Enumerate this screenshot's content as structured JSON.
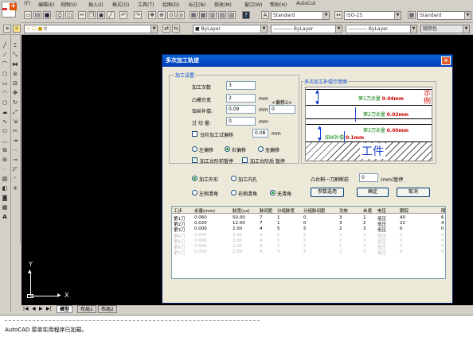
{
  "menu": {
    "items": [
      "(F)",
      "编辑(E)",
      "视图(V)",
      "插入(I)",
      "格式(O)",
      "工具(T)",
      "绘图(D)",
      "标注(N)",
      "修改(M)",
      "窗口(W)",
      "帮助(H)",
      "AutoCut"
    ]
  },
  "toolbar": {
    "text_style": "Standard",
    "dim_style": "ISO-25",
    "table_style": "Standard",
    "layer_value": "0",
    "color_value": "ByLayer",
    "linetype_value": "ByLayer",
    "lineweight_value": "ByLayer",
    "plotstyle_value": "随颜色"
  },
  "canvas": {
    "y_axis": "Y",
    "x_axis": "X"
  },
  "layout_tabs": [
    "模型",
    "布局1",
    "布局2"
  ],
  "command_line": "AutoCAD 菜单实用程序已加载。",
  "dialog": {
    "title": "多次加工轨迹",
    "close_label": "×",
    "settings_group": "加工设置",
    "times_label": "加工次数",
    "times_value": "3",
    "platform_label": "凸模台宽",
    "platform_value": "2",
    "platform_unit": "mm",
    "offset_label": "<偏移2>",
    "offset_value": "0",
    "wire_label": "钼丝补偿:",
    "wire_value": "0.09",
    "wire_unit": "mm",
    "overcut_label": "过 切 量:",
    "overcut_value": "0",
    "overcut_unit": "mm",
    "platform_cut_label": "台阶加工试偏移",
    "platform_cut_value": "0.08",
    "platform_cut_unit": "mm",
    "offset_left": "左偏移",
    "offset_right": "右偏移",
    "offset_none": "无偏移",
    "pause_before": "加工台阶前暂停",
    "pause_after": "加工台阶后 暂停",
    "diagram_group": "多次加工补偿示意图",
    "diagram": {
      "cut1": "第1刀余量",
      "cut1_val": "0.04mm",
      "cut2": "第2刀余量",
      "cut2_val": "0.02mm",
      "cut3": "第3刀余量",
      "cut3_val": "0.00mm",
      "wire": "钼丝补偿",
      "wire_val": "0.1mm",
      "example": "示例",
      "workpiece": "工件"
    },
    "shape_outer": "加工外形",
    "shape_inner": "加工内孔",
    "corner_left": "左侧清角",
    "corner_right": "右侧清角",
    "corner_none": "无清角",
    "pause_label": "凸台割一刀割断前",
    "pause_value": "0",
    "pause_unit": "(mm)暂停",
    "params_button": "参数选用",
    "ok_button": "确定",
    "cancel_button": "取消",
    "table": {
      "headers": [
        "工步",
        "余量(mm)",
        "脉宽(us)",
        "脉间距",
        "分组脉宽",
        "分组脉间距",
        "功放",
        "丝速",
        "电压",
        "跟踪",
        "限"
      ],
      "rows": [
        [
          "第1刀",
          "0.060",
          "50.00",
          "7",
          "1",
          "0",
          "3",
          "1",
          "低压",
          "40",
          "6"
        ],
        [
          "第2刀",
          "0.020",
          "12.00",
          "7",
          "1",
          "0",
          "3",
          "2",
          "低压",
          "22",
          "4"
        ],
        [
          "第3刀",
          "0.000",
          "2.00",
          "4",
          "5",
          "5",
          "2",
          "3",
          "低压",
          "0",
          "0"
        ],
        [
          "第4刀",
          "0.000",
          "2.00",
          "4",
          "5",
          "5",
          "2",
          "3",
          "低压",
          "0",
          "0"
        ],
        [
          "第5刀",
          "0.000",
          "2.00",
          "4",
          "5",
          "5",
          "2",
          "3",
          "低压",
          "0",
          "0"
        ],
        [
          "第6刀",
          "0.000",
          "2.00",
          "4",
          "5",
          "5",
          "2",
          "3",
          "低压",
          "0",
          "0"
        ],
        [
          "第7刀",
          "0.000",
          "2.00",
          "4",
          "5",
          "5",
          "2",
          "3",
          "低压",
          "0",
          "0"
        ]
      ]
    }
  }
}
